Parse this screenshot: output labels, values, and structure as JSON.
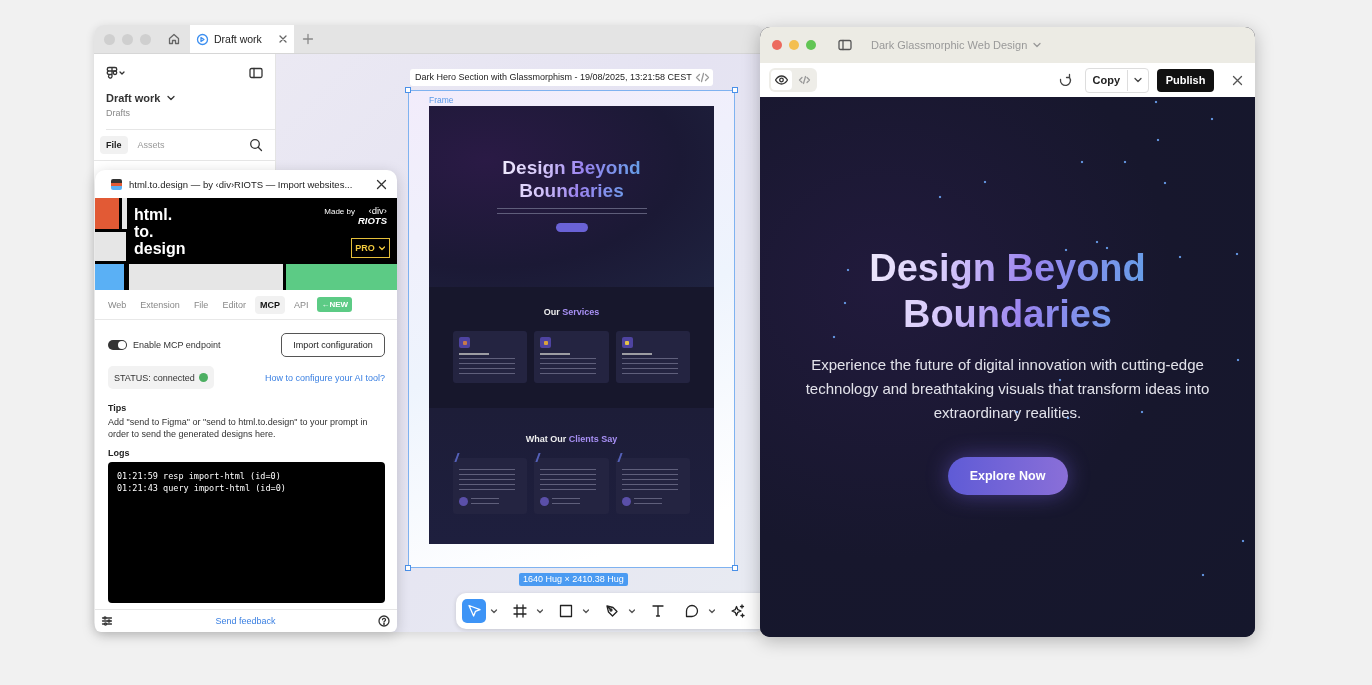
{
  "editor_window": {
    "tabs": [
      {
        "label": "Draft work"
      }
    ],
    "sidebar": {
      "file_name": "Draft work",
      "location": "Drafts",
      "tabs": [
        {
          "label": "File",
          "selected": true
        },
        {
          "label": "Assets",
          "selected": false
        }
      ]
    },
    "canvas": {
      "frame_title": "Dark Hero Section with Glassmorphism - 19/08/2025, 13:21:58 CEST",
      "frame_label": "Frame",
      "size_badge": "1640 Hug × 2410.38 Hug",
      "thumbnail": {
        "hero_title": "Design Beyond Boundaries",
        "services_title": {
          "lead": "Our",
          "accent": "Services"
        },
        "clients_title": {
          "lead": "What Our",
          "accent": "Clients Say"
        }
      },
      "tools": [
        {
          "kind": "move",
          "selected": true,
          "has_menu": true
        },
        {
          "kind": "frame",
          "selected": false,
          "has_menu": true
        },
        {
          "kind": "rectangle",
          "selected": false,
          "has_menu": true
        },
        {
          "kind": "pen",
          "selected": false,
          "has_menu": true
        },
        {
          "kind": "text",
          "selected": false,
          "has_menu": false
        },
        {
          "kind": "comment",
          "selected": false,
          "has_menu": true
        },
        {
          "kind": "ai",
          "selected": false,
          "has_menu": false
        }
      ]
    }
  },
  "plugin": {
    "title": "html.to.design — by ‹div›RIOTS — Import websites...",
    "banner": {
      "logo_lines": [
        "html.",
        "to.",
        "design"
      ],
      "made_by": "Made by",
      "maker_lines": [
        "‹div›",
        "RIOTS"
      ],
      "plan_button": "PRO"
    },
    "tabs": [
      {
        "label": "Web",
        "selected": false
      },
      {
        "label": "Extension",
        "selected": false
      },
      {
        "label": "File",
        "selected": false
      },
      {
        "label": "Editor",
        "selected": false
      },
      {
        "label": "MCP",
        "selected": true
      },
      {
        "label": "API",
        "selected": false
      }
    ],
    "new_badge": "←NEW",
    "mcp_toggle": {
      "label": "Enable MCP endpoint",
      "on": true
    },
    "import_button": "Import configuration",
    "status": {
      "text": "STATUS: connected",
      "connected": true
    },
    "help_link": "How to configure your AI tool?",
    "tips_heading": "Tips",
    "tips_text": "Add \"send to Figma\" or \"send to html.to.design\" to your prompt in order to send the generated designs here.",
    "logs_heading": "Logs",
    "logs": [
      "01:21:59 resp import-html (id=0)",
      "01:21:43 query import-html (id=0)"
    ],
    "feedback_link": "Send feedback"
  },
  "preview_window": {
    "title": "Dark Glassmorphic Web Design",
    "view_modes": [
      {
        "kind": "preview",
        "selected": true
      },
      {
        "kind": "code",
        "selected": false
      }
    ],
    "copy_button": "Copy",
    "publish_button": "Publish",
    "hero": {
      "title": "Design Beyond Boundaries",
      "text": "Experience the future of digital innovation with cutting-edge technology and breathtaking visuals that transform ideas into extraordinary realities.",
      "button": "Explore Now"
    }
  }
}
